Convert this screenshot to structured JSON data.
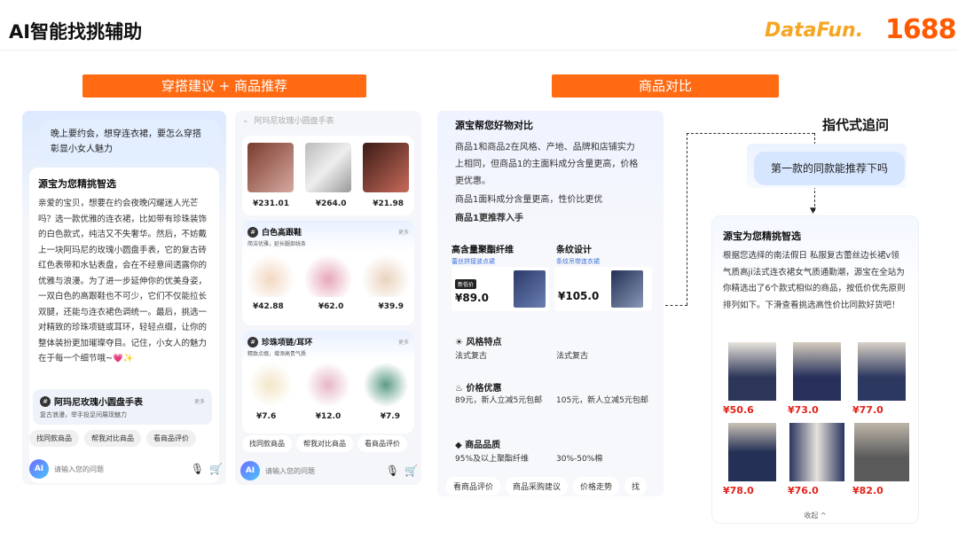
{
  "header": {
    "title": "AI智能找挑辅助",
    "logo_datafun": "DataFun.",
    "logo_1688": "1688"
  },
  "sections": {
    "left_label": "穿搭建议 + 商品推荐",
    "right_label": "商品对比",
    "followup_label": "指代式追问"
  },
  "phone1": {
    "question": "晚上要约会，想穿连衣裙，要怎么穿搭彰显小女人魅力",
    "answer_title": "源宝为您精挑智选",
    "answer_body": "亲爱的宝贝，想要在约会夜晚闪耀迷人光芒吗？选一款优雅的连衣裙，比如带有珍珠装饰的白色款式，纯洁又不失奢华。然后，不妨戴上一块阿玛尼的玫瑰小圆盘手表，它的复古砖红色表带和水钻表盘，会在不经意间透露你的优雅与浪漫。为了进一步延伸你的优美身姿，一双白色的高跟鞋也不可少，它们不仅能拉长双腿，还能与连衣裙色调统一。最后，挑选一对精致的珍珠项链或耳环，轻轻点缀，让你的整体装扮更加璀璨夺目。记住，小女人的魅力在于每一个细节哦~💗✨",
    "rec_title": "阿玛尼玫瑰小圆盘手表",
    "rec_sub": "复古浪漫，举手投足间展现魅力",
    "rec_more": "更多",
    "chips": [
      "找同款商品",
      "帮我对比商品",
      "看商品评价"
    ],
    "input_placeholder": "请输入您的问题",
    "ai_icon": "AI"
  },
  "phone2": {
    "header_ghost": "阿玛尼玫瑰小圆盘手表",
    "watch_prices": [
      "¥231.01",
      "¥264.0",
      "¥21.98"
    ],
    "shoes_title": "白色高跟鞋",
    "shoes_sub": "简洁优雅，延长腿部线条",
    "shoes_prices": [
      "¥42.88",
      "¥62.0",
      "¥39.9"
    ],
    "jewelry_title": "珍珠项链/耳环",
    "jewelry_sub": "精致点缀，增添高贵气质",
    "jewelry_prices": [
      "¥7.6",
      "¥12.0",
      "¥7.9"
    ],
    "more": "更多",
    "chips": [
      "找同款商品",
      "帮我对比商品",
      "看商品评价"
    ],
    "input_placeholder": "请输入您的问题"
  },
  "compare": {
    "title": "源宝帮您好物对比",
    "para1": "商品1和商品2在风格、产地、品牌和店铺实力上相同，但商品1的主面料成分含量更高，价格更优惠。",
    "para2": "商品1面料成分含量更高，性价比更优",
    "para3": "商品1更推荐入手",
    "p1_name": "高含量聚酯纤维",
    "p1_sub": "蕾丝拼接波点裙",
    "p1_badge": "新低价",
    "p1_price": "¥89.0",
    "p2_name": "条纹设计",
    "p2_sub": "条纹吊带连衣裙",
    "p2_price": "¥105.0",
    "rows": [
      {
        "label": "风格特点",
        "v1": "法式复古",
        "v2": "法式复古"
      },
      {
        "label": "价格优惠",
        "v1": "89元，新人立减5元包邮",
        "v2": "105元，新人立减5元包邮"
      },
      {
        "label": "商品品质",
        "v1": "95%及以上聚酯纤维",
        "v2": "30%-50%棉"
      }
    ],
    "chips": [
      "看商品评价",
      "商品采购建议",
      "价格走势",
      "找"
    ]
  },
  "followup": {
    "question": "第一款的同款能推荐下吗",
    "answer_title": "源宝为您精挑智选",
    "answer_body": "根据您选择的南法假日 私服复古蕾丝边长裙v领气质高ji法式连衣裙女气质通勤潮，源宝在全站为你精选出了6个款式相似的商品，按低价优先原则排列如下。下滑查看挑选高性价比同款好货吧！",
    "prices": [
      "¥50.6",
      "¥73.0",
      "¥77.0",
      "¥78.0",
      "¥76.0",
      "¥82.0"
    ],
    "collapse": "收起"
  },
  "colors": {
    "accent": "#ff6a13",
    "price_red": "#e2231a",
    "bubble": "#e3efff"
  }
}
